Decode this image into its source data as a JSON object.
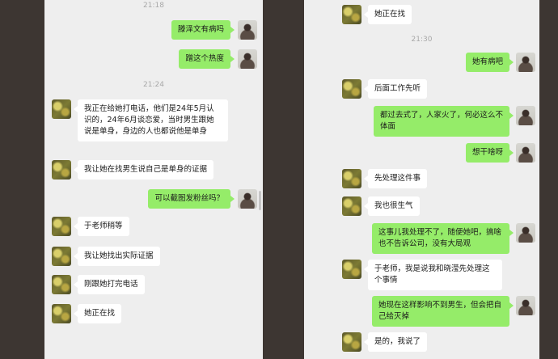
{
  "left": {
    "timestamps": [
      "21:18",
      "21:24"
    ],
    "messages": [
      {
        "sender": "self",
        "text": "滕泽文有病吗"
      },
      {
        "sender": "self",
        "text": "蹭这个热度"
      },
      {
        "sender": "friend",
        "text": "我正在给她打电话，他们是24年5月认识的，24年6月谈恋爱，当时男生跟她说是单身，身边的人也都说他是单身"
      },
      {
        "sender": "friend",
        "text": "我让她在找男生说自己是单身的证据"
      },
      {
        "sender": "self",
        "text": "可以截图发粉丝吗？"
      },
      {
        "sender": "friend",
        "text": "于老师稍等"
      },
      {
        "sender": "friend",
        "text": "我让她找出实际证据"
      },
      {
        "sender": "friend",
        "text": "刚跟她打完电话"
      },
      {
        "sender": "friend",
        "text": "她正在找"
      }
    ]
  },
  "right": {
    "timestamps": [
      "21:30"
    ],
    "messages": [
      {
        "sender": "friend",
        "text": "她正在找"
      },
      {
        "sender": "self",
        "text": "她有病吧"
      },
      {
        "sender": "friend",
        "text": "后面工作先听"
      },
      {
        "sender": "self",
        "text": "都过去式了，人家火了，何必这么不体面"
      },
      {
        "sender": "self",
        "text": "想干啥呀"
      },
      {
        "sender": "friend",
        "text": "先处理这件事"
      },
      {
        "sender": "friend",
        "text": "我也很生气"
      },
      {
        "sender": "self",
        "text": "这事儿我处理不了，随便她吧，搞啥也不告诉公司，没有大局观"
      },
      {
        "sender": "friend",
        "text": "于老师，我是说我和晓滢先处理这个事情"
      },
      {
        "sender": "self",
        "text": "她现在这样影响不到男生，但会把自己给灭掉"
      },
      {
        "sender": "friend",
        "text": "是的，我说了"
      }
    ]
  }
}
